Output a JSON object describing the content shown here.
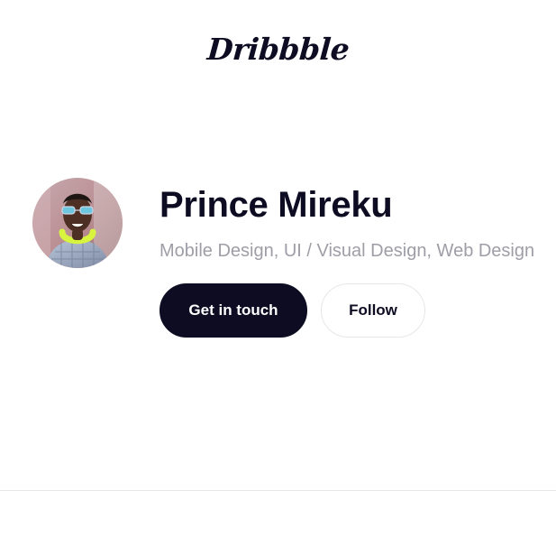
{
  "brand": {
    "logo_text": "Dribbble"
  },
  "profile": {
    "name": "Prince Mireku",
    "skills": "Mobile Design, UI / Visual Design, Web Design",
    "avatar_icon": "user-avatar-photo"
  },
  "actions": {
    "primary_label": "Get in touch",
    "secondary_label": "Follow"
  },
  "colors": {
    "text": "#0d0c22",
    "muted": "#9e9ea7",
    "border": "#e7e7e9",
    "background": "#ffffff"
  }
}
